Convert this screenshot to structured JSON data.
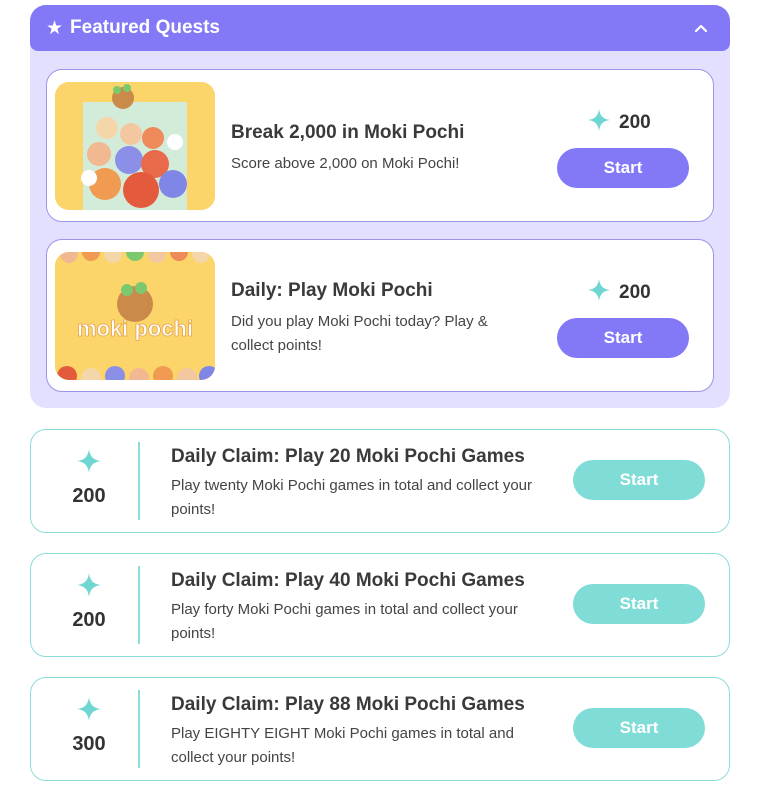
{
  "colors": {
    "purple": "#8379f6",
    "purple_panel": "#e3e0ff",
    "teal": "#80dcd7",
    "sparkle": "#6fd6d2"
  },
  "featured": {
    "icon": "star-icon",
    "title": "Featured Quests",
    "collapse_icon": "chevron-up-icon",
    "cards": [
      {
        "title": "Break 2,000 in Moki Pochi",
        "description": "Score above 2,000 on Moki Pochi!",
        "points": "200",
        "button": "Start",
        "image": "moki-pochi-gameplay-thumbnail"
      },
      {
        "title": "Daily: Play Moki Pochi",
        "description": "Did you play Moki Pochi today? Play & collect points!",
        "points": "200",
        "button": "Start",
        "image": "moki-pochi-logo-thumbnail",
        "image_text": "moki pochi"
      }
    ]
  },
  "quests": [
    {
      "points": "200",
      "title": "Daily Claim: Play 20 Moki Pochi Games",
      "description": "Play twenty Moki Pochi games in total and collect your points!",
      "button": "Start"
    },
    {
      "points": "200",
      "title": "Daily Claim: Play 40 Moki Pochi Games",
      "description": "Play forty Moki Pochi games in total and collect your points!",
      "button": "Start"
    },
    {
      "points": "300",
      "title": "Daily Claim: Play 88 Moki Pochi Games",
      "description": "Play EIGHTY EIGHT Moki Pochi games in total and collect your points!",
      "button": "Start"
    }
  ]
}
